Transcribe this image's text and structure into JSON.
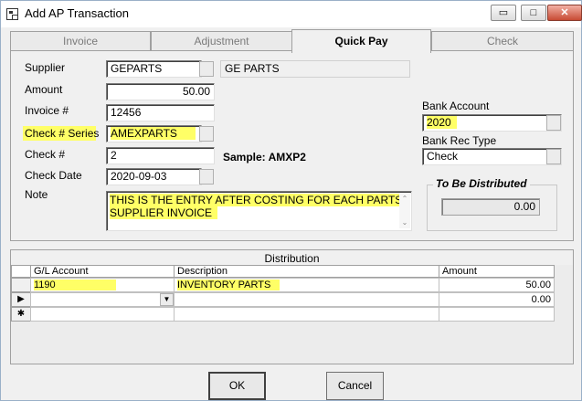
{
  "window": {
    "title": "Add AP Transaction",
    "minimize_glyph": "▭",
    "maximize_glyph": "□",
    "close_glyph": "✕"
  },
  "tabs": [
    {
      "label": "Invoice",
      "active": false
    },
    {
      "label": "Adjustment",
      "active": false
    },
    {
      "label": "Quick Pay",
      "active": true
    },
    {
      "label": "Check",
      "active": false
    }
  ],
  "form": {
    "supplier_label": "Supplier",
    "supplier_code": "GEPARTS",
    "supplier_name": "GE PARTS",
    "amount_label": "Amount",
    "amount": "50.00",
    "invoice_label": "Invoice #",
    "invoice": "12456",
    "check_series_label": "Check # Series",
    "check_series": "AMEXPARTS",
    "check_num_label": "Check  #",
    "check_num": "2",
    "sample_text": "Sample: AMXP2",
    "check_date_label": "Check Date",
    "check_date": "2020-09-03",
    "note_label": "Note",
    "note_line1": "THIS IS THE ENTRY AFTER COSTING FOR EACH PARTS",
    "note_line2": "SUPPLIER INVOICE",
    "bank_account_label": "Bank Account",
    "bank_account": "2020",
    "bank_rec_type_label": "Bank Rec Type",
    "bank_rec_type": "Check",
    "to_be_distributed_label": "To Be Distributed",
    "to_be_distributed": "0.00"
  },
  "distribution": {
    "title": "Distribution",
    "columns": [
      "G/L Account",
      "Description",
      "Amount"
    ],
    "rows": [
      {
        "selector": "",
        "gl_account": "1190",
        "description": "INVENTORY PARTS",
        "amount": "50.00"
      },
      {
        "selector": "▶",
        "gl_account": "",
        "description": "",
        "amount": "0.00"
      },
      {
        "selector": "✱",
        "gl_account": "",
        "description": "",
        "amount": ""
      }
    ]
  },
  "buttons": {
    "ok": "OK",
    "cancel": "Cancel"
  },
  "colors": {
    "highlight": "#ffff66",
    "window_bg": "#f0f0f0"
  }
}
